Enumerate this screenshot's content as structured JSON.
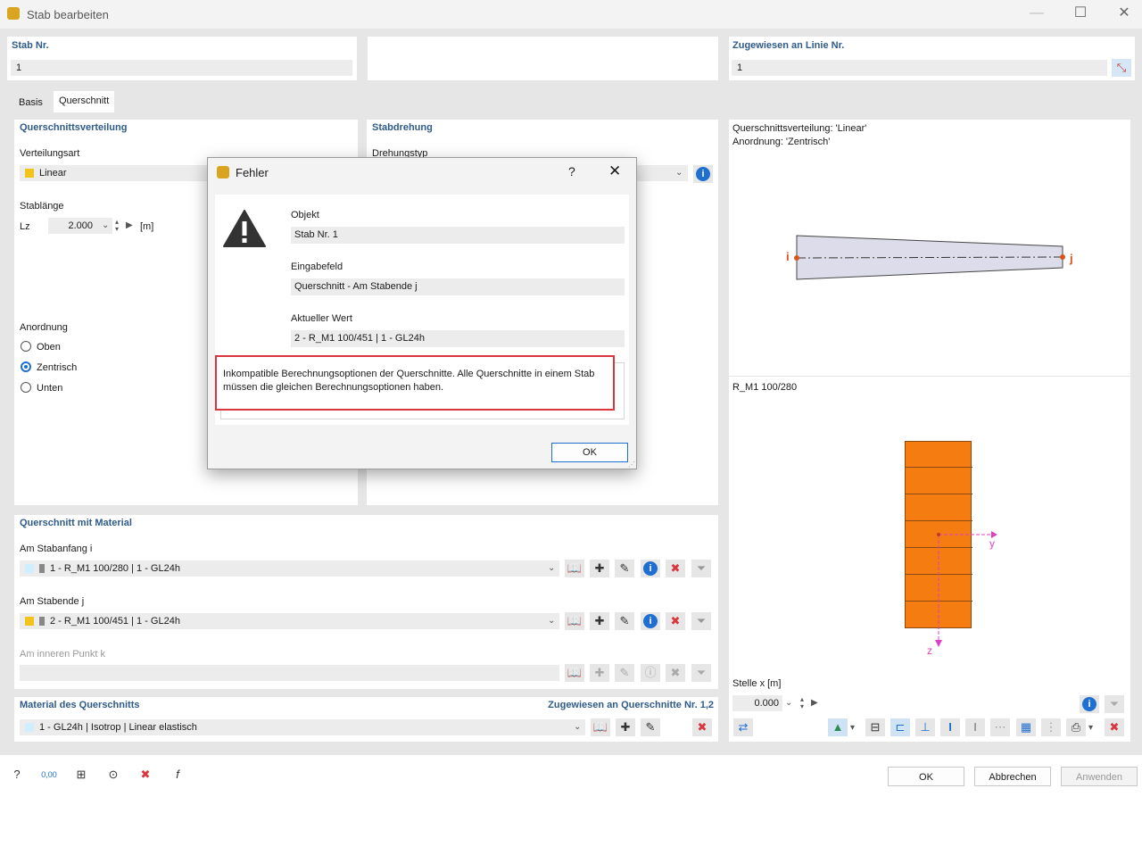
{
  "window": {
    "title": "Stab bearbeiten"
  },
  "top_fields": {
    "member_no_label": "Stab Nr.",
    "member_no_value": "1",
    "assigned_line_label": "Zugewiesen an Linie Nr.",
    "assigned_line_value": "1"
  },
  "tabs": [
    {
      "label": "Basis"
    },
    {
      "label": "Querschnitt"
    }
  ],
  "distribution": {
    "section_title": "Querschnittsverteilung",
    "type_label": "Verteilungsart",
    "type_value": "Linear",
    "type_color": "#f0c419",
    "length_label": "Stablänge",
    "length_symbol": "Lz",
    "length_value": "2.000",
    "length_unit": "[m]",
    "alignment_label": "Anordnung",
    "alignment_options": [
      {
        "label": "Oben",
        "selected": false
      },
      {
        "label": "Zentrisch",
        "selected": true
      },
      {
        "label": "Unten",
        "selected": false
      }
    ]
  },
  "rotation": {
    "section_title": "Stabdrehung",
    "type_label": "Drehungstyp"
  },
  "preview": {
    "info_line1": "Querschnittsverteilung: 'Linear'",
    "info_line2": "Anordnung: 'Zentrisch'",
    "node_i": "i",
    "node_j": "j",
    "section_name": "R_M1 100/280",
    "axis_y": "y",
    "axis_z": "z",
    "position_label": "Stelle x [m]",
    "position_value": "0.000",
    "section_fill_color": "#f57c11"
  },
  "cross_section": {
    "section_title": "Querschnitt mit Material",
    "start_label": "Am Stabanfang i",
    "start_value": "1 - R_M1 100/280 | 1 - GL24h",
    "start_color": "#cfeeff",
    "end_label": "Am Stabende j",
    "end_value": "2 - R_M1 100/451 | 1 - GL24h",
    "end_color": "#f0c419",
    "inner_label": "Am inneren Punkt k"
  },
  "material": {
    "section_title": "Material des Querschnitts",
    "assigned_label": "Zugewiesen an Querschnitte Nr. 1,2",
    "value": "1 - GL24h | Isotrop | Linear elastisch",
    "color": "#cfeeff"
  },
  "buttons": {
    "ok": "OK",
    "cancel": "Abbrechen",
    "apply": "Anwenden"
  },
  "dialog": {
    "title": "Fehler",
    "help": "?",
    "object_label": "Objekt",
    "object_value": "Stab Nr. 1",
    "input_label": "Eingabefeld",
    "input_value": "Querschnitt - Am Stabende j",
    "current_label": "Aktueller Wert",
    "current_value": "2 - R_M1 100/451 | 1 - GL24h",
    "message": "Inkompatible Berechnungsoptionen der Querschnitte. Alle Querschnitte in einem Stab müssen die gleichen Berechnungsoptionen haben.",
    "ok": "OK"
  },
  "footer_tools": {
    "units_label": "0,00"
  }
}
